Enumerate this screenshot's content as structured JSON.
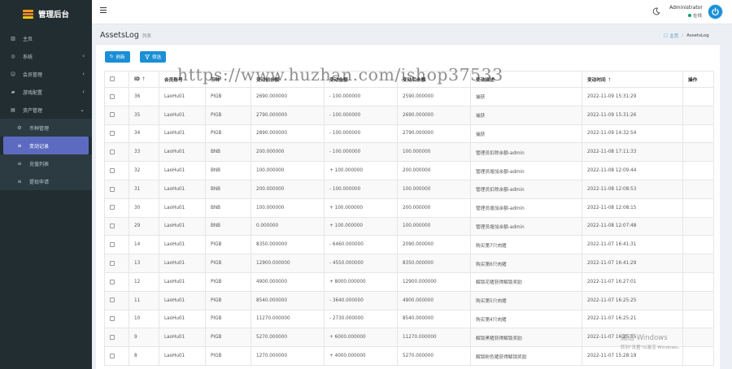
{
  "sidebar": {
    "brand": "管理后台",
    "items": [
      {
        "label": "主页",
        "icon": "dashboard-icon",
        "arrow": ""
      },
      {
        "label": "系统",
        "icon": "gear-icon",
        "arrow": "‹"
      },
      {
        "label": "会员管理",
        "icon": "users-icon",
        "arrow": "‹"
      },
      {
        "label": "游戏配置",
        "icon": "gamepad-icon",
        "arrow": "‹"
      },
      {
        "label": "资产管理",
        "icon": "assets-icon",
        "arrow": "⌄"
      },
      {
        "label": "币种管理",
        "icon": "coin-icon",
        "arrow": "",
        "sub": true
      },
      {
        "label": "变动记录",
        "icon": "list-icon",
        "arrow": "",
        "sub": true,
        "active": true
      },
      {
        "label": "充值列表",
        "icon": "list-icon",
        "arrow": "",
        "sub": true
      },
      {
        "label": "提现申请",
        "icon": "list-icon",
        "arrow": "",
        "sub": true
      }
    ]
  },
  "topbar": {
    "user_name": "Administrator",
    "user_status": "在线"
  },
  "page": {
    "title": "AssetsLog",
    "subtitle": "列表",
    "breadcrumb_home": "主页",
    "breadcrumb_current": "AssetsLog"
  },
  "toolbar": {
    "refresh_label": "刷新",
    "filter_label": "筛选"
  },
  "table": {
    "headers": {
      "id": "ID",
      "id_sort": "↑",
      "user": "会员账号",
      "coin": "币种",
      "before": "变动前余额",
      "change": "变动金额",
      "after": "变动后余额",
      "remark": "变动描述",
      "time": "变动时间",
      "time_sort": "↑",
      "action": "操作"
    },
    "rows": [
      {
        "id": "36",
        "user": "LaoHu01",
        "coin": "PIGB",
        "before": "2690.000000",
        "change": "- 100.000000",
        "after": "2590.000000",
        "remark": "捕获",
        "time": "2022-11-09 15:31:29"
      },
      {
        "id": "35",
        "user": "LaoHu01",
        "coin": "PIGB",
        "before": "2790.000000",
        "change": "- 100.000000",
        "after": "2690.000000",
        "remark": "捕获",
        "time": "2022-11-09 15:31:26"
      },
      {
        "id": "34",
        "user": "LaoHu01",
        "coin": "PIGB",
        "before": "2890.000000",
        "change": "- 100.000000",
        "after": "2790.000000",
        "remark": "捕获",
        "time": "2022-11-09 14:32:54"
      },
      {
        "id": "33",
        "user": "LaoHu01",
        "coin": "BNB",
        "before": "200.000000",
        "change": "- 100.000000",
        "after": "100.000000",
        "remark": "管理员扣除余额-admin",
        "time": "2022-11-08 17:11:33"
      },
      {
        "id": "32",
        "user": "LaoHu01",
        "coin": "BNB",
        "before": "100.000000",
        "change": "+ 100.000000",
        "after": "200.000000",
        "remark": "管理员增加余额-admin",
        "time": "2022-11-08 12:09:44"
      },
      {
        "id": "31",
        "user": "LaoHu01",
        "coin": "BNB",
        "before": "200.000000",
        "change": "- 100.000000",
        "after": "100.000000",
        "remark": "管理员扣除余额-admin",
        "time": "2022-11-08 12:08:53"
      },
      {
        "id": "30",
        "user": "LaoHu01",
        "coin": "BNB",
        "before": "100.000000",
        "change": "+ 100.000000",
        "after": "200.000000",
        "remark": "管理员增加余额-admin",
        "time": "2022-11-08 12:08:15"
      },
      {
        "id": "29",
        "user": "LaoHu01",
        "coin": "BNB",
        "before": "0.000000",
        "change": "+ 100.000000",
        "after": "100.000000",
        "remark": "管理员增加余额-admin",
        "time": "2022-11-08 12:07:48"
      },
      {
        "id": "14",
        "user": "LaoHu01",
        "coin": "PIGB",
        "before": "8350.000000",
        "change": "- 6460.000000",
        "after": "2090.000000",
        "remark": "购买第7只肉猪",
        "time": "2022-11-07 16:41:31"
      },
      {
        "id": "13",
        "user": "LaoHu01",
        "coin": "PIGB",
        "before": "12900.000000",
        "change": "- 4550.000000",
        "after": "8350.000000",
        "remark": "购买第6只肉猪",
        "time": "2022-11-07 16:41:29"
      },
      {
        "id": "12",
        "user": "LaoHu01",
        "coin": "PIGB",
        "before": "4900.000000",
        "change": "+ 8000.000000",
        "after": "12900.000000",
        "remark": "解锁花猪获得解锁奖励",
        "time": "2022-11-07 16:27:01"
      },
      {
        "id": "11",
        "user": "LaoHu01",
        "coin": "PIGB",
        "before": "8540.000000",
        "change": "- 3640.000000",
        "after": "4900.000000",
        "remark": "购买第5只肉猪",
        "time": "2022-11-07 16:25:25"
      },
      {
        "id": "10",
        "user": "LaoHu01",
        "coin": "PIGB",
        "before": "11270.000000",
        "change": "- 2730.000000",
        "after": "8540.000000",
        "remark": "购买第4只肉猪",
        "time": "2022-11-07 16:25:21"
      },
      {
        "id": "9",
        "user": "LaoHu01",
        "coin": "PIGB",
        "before": "5270.000000",
        "change": "+ 6000.000000",
        "after": "11270.000000",
        "remark": "解锁黑猪获得解锁奖励",
        "time": "2022-11-07 16:25:15"
      },
      {
        "id": "8",
        "user": "LaoHu01",
        "coin": "PIGB",
        "before": "1270.000000",
        "change": "+ 4000.000000",
        "after": "5270.000000",
        "remark": "解锁粉色猪获得解锁奖励",
        "time": "2022-11-07 15:28:19"
      }
    ]
  },
  "overlay": {
    "watermark": "https://www.huzhan.com/ishop37533",
    "activate_line1": "激活 Windows",
    "activate_line2": "转到\"设置\"以激活 Windows。"
  }
}
